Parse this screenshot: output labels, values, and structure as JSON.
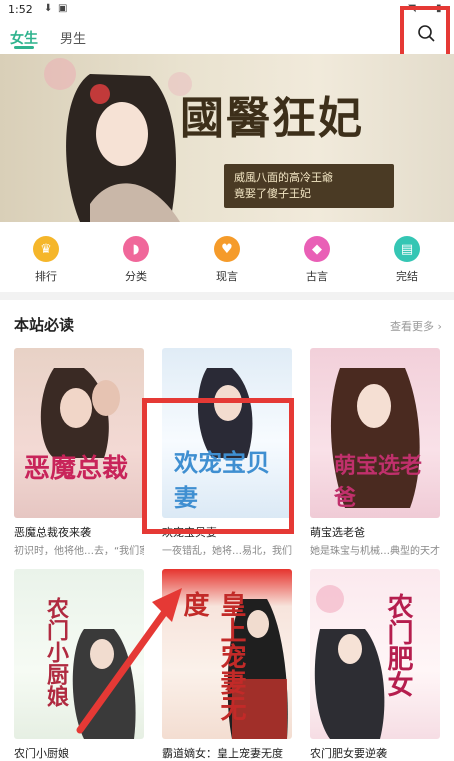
{
  "status": {
    "time": "1:52"
  },
  "tabs": {
    "female": "女生",
    "male": "男生"
  },
  "banner": {
    "title": "國醫狂妃",
    "subtitle_line1": "威風八面的高冷王爺",
    "subtitle_line2": "竟娶了傻子王妃"
  },
  "categories": [
    {
      "label": "排行",
      "icon": "trophy-icon",
      "color": "#f5b62a"
    },
    {
      "label": "分类",
      "icon": "shoe-icon",
      "color": "#f0679a"
    },
    {
      "label": "现言",
      "icon": "heart-icon",
      "color": "#f59b2a"
    },
    {
      "label": "古言",
      "icon": "tag-icon",
      "color": "#e95fb6"
    },
    {
      "label": "完结",
      "icon": "book-icon",
      "color": "#35c6b4"
    }
  ],
  "section": {
    "title": "本站必读",
    "more": "查看更多"
  },
  "books": [
    {
      "title": "恶魔总裁夜来袭",
      "desc": "初识时，他将他…去，“我们家的",
      "cover_text": "恶魔总裁"
    },
    {
      "title": "欢宠宝贝妻",
      "desc": "一夜错乱，她将…易北，我们是协",
      "cover_text": "欢宠宝贝妻"
    },
    {
      "title": "萌宝选老爸",
      "desc": "她是珠宝与机械…典型的天才与白",
      "cover_text": "萌宝选老爸"
    },
    {
      "title": "农门小厨娘",
      "desc": "",
      "cover_text": "农门小厨娘"
    },
    {
      "title": "霸道嫡女：皇上宠妻无度",
      "desc": "",
      "cover_text": "皇上宠妻无度"
    },
    {
      "title": "农门肥女要逆袭",
      "desc": "",
      "cover_text": "农门肥女"
    }
  ]
}
